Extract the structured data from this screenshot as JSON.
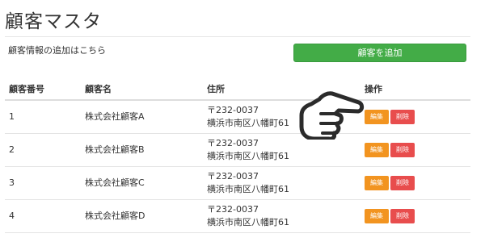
{
  "page": {
    "title": "顧客マスタ",
    "add_info": "顧客情報の追加はこちら",
    "add_button_label": "顧客を追加"
  },
  "table": {
    "headers": {
      "id": "顧客番号",
      "name": "顧客名",
      "address": "住所",
      "operations": "操作"
    },
    "rows": [
      {
        "id": "1",
        "name": "株式会社顧客A",
        "postal": "〒232-0037",
        "address": "横浜市南区八幡町61",
        "edit": "編集",
        "delete": "削除"
      },
      {
        "id": "2",
        "name": "株式会社顧客B",
        "postal": "〒232-0037",
        "address": "横浜市南区八幡町61",
        "edit": "編集",
        "delete": "削除"
      },
      {
        "id": "3",
        "name": "株式会社顧客C",
        "postal": "〒232-0037",
        "address": "横浜市南区八幡町61",
        "edit": "編集",
        "delete": "削除"
      },
      {
        "id": "4",
        "name": "株式会社顧客D",
        "postal": "〒232-0037",
        "address": "横浜市南区八幡町61",
        "edit": "編集",
        "delete": "削除"
      }
    ]
  },
  "colors": {
    "add_button": "#43ac47",
    "edit_button": "#f29420",
    "delete_button": "#e84d4d"
  },
  "icons": {
    "pointer": "pointing-hand-icon"
  }
}
